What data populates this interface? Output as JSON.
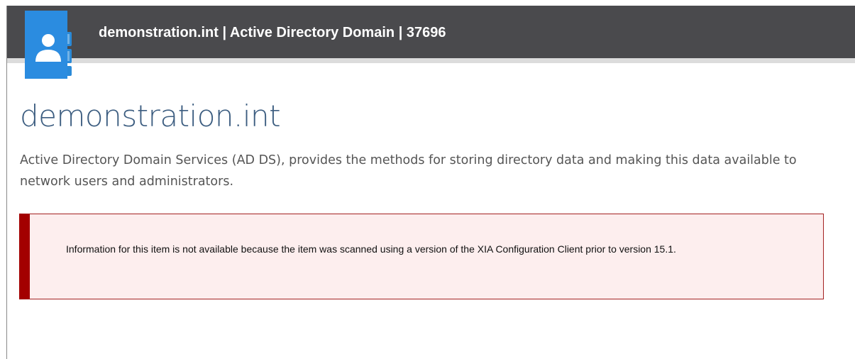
{
  "header": {
    "title": "demonstration.int | Active Directory Domain | 37696",
    "icon": "address-book-user-icon",
    "background_color": "#4a4a4d"
  },
  "main": {
    "title": "demonstration.int",
    "description": "Active Directory Domain Services (AD DS), provides the methods for storing directory data and making this data available to network users and administrators."
  },
  "alert": {
    "message": "Information for this item is not available because the item was scanned using a version of the XIA Configuration Client prior to version 15.1.",
    "accent_color": "#a30000",
    "background_color": "#fdeeee"
  }
}
